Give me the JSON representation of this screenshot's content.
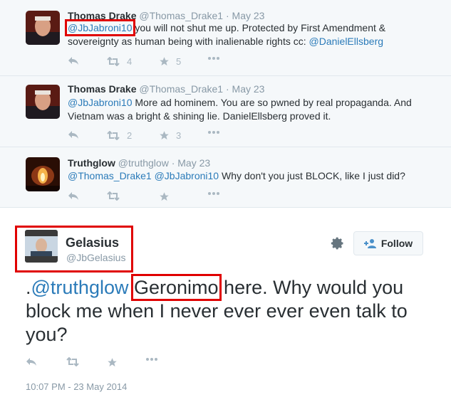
{
  "replies": [
    {
      "name": "Thomas Drake",
      "handle": "@Thomas_Drake1",
      "date": "May 23",
      "text_link": "@JbJabroni10",
      "text_rest": " you will not shut me up. Protected by First Amendment & sovereignty as human being with inalienable rights cc: ",
      "text_link2": "@DanielEllsberg",
      "retweets": "4",
      "favorites": "5"
    },
    {
      "name": "Thomas Drake",
      "handle": "@Thomas_Drake1",
      "date": "May 23",
      "text_link": "@JbJabroni10",
      "text_rest": " More ad hominem. You are so pwned by real propaganda. And Vietnam was a bright & shining lie. DanielEllsberg proved it.",
      "retweets": "2",
      "favorites": "3"
    },
    {
      "name": "Truthglow",
      "handle": "@truthglow",
      "date": "May 23",
      "text_link": "@Thomas_Drake1",
      "text_link2": "@JbJabroni10",
      "text_rest": " Why don't you just BLOCK, like I just did?"
    }
  ],
  "main": {
    "name": "Gelasius",
    "handle": "@JbGelasius",
    "follow_label": "Follow",
    "text_prefix": ".",
    "text_link": "@truthglow",
    "text_highlight": "Geronimo",
    "text_rest": " here. Why would you block me when I never ever ever even talk to you?",
    "timestamp": "10:07 PM - 23 May 2014"
  },
  "colors": {
    "link": "#2b7bb9",
    "highlight": "#e00000",
    "muted": "#8899a6"
  }
}
